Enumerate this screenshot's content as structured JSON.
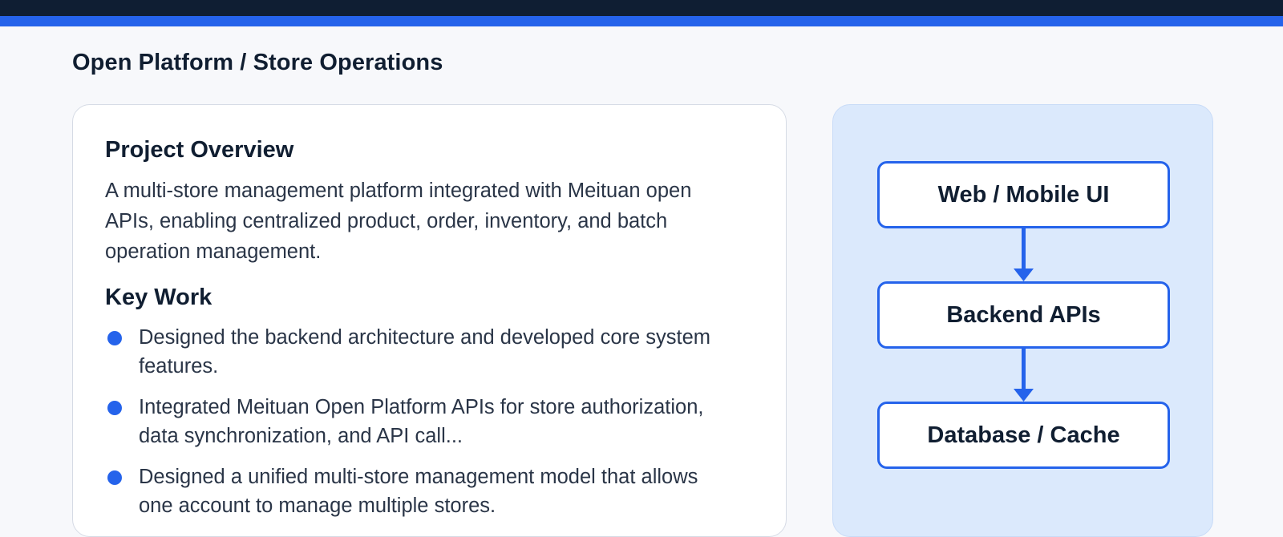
{
  "page": {
    "title": "Open Platform / Store Operations"
  },
  "overview": {
    "heading": "Project Overview",
    "text": "A multi-store management platform integrated with Meituan open APIs, enabling centralized product, order, inventory, and batch operation management."
  },
  "key_work": {
    "heading": "Key Work",
    "items": [
      "Designed the backend architecture and developed core system features.",
      "Integrated Meituan Open Platform APIs for store authorization, data synchronization, and API call...",
      "Designed a unified multi-store management model that allows one account to manage multiple stores."
    ]
  },
  "architecture": {
    "layers": [
      "Web / Mobile UI",
      "Backend APIs",
      "Database / Cache"
    ]
  },
  "colors": {
    "accent": "#2563eb",
    "header": "#0f1e33",
    "diagram_bg": "#dbe9fc"
  }
}
